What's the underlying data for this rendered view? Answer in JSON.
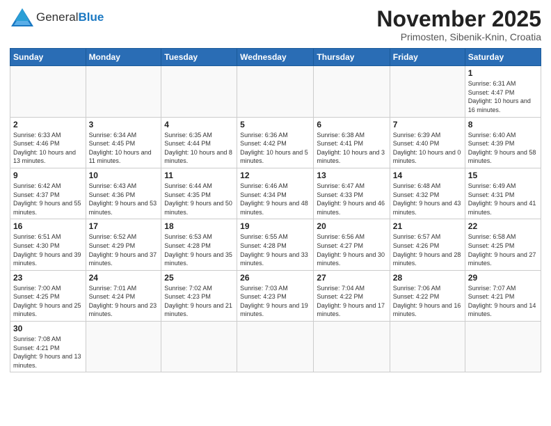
{
  "logo": {
    "text_general": "General",
    "text_blue": "Blue"
  },
  "header": {
    "month_title": "November 2025",
    "subtitle": "Primosten, Sibenik-Knin, Croatia"
  },
  "weekdays": [
    "Sunday",
    "Monday",
    "Tuesday",
    "Wednesday",
    "Thursday",
    "Friday",
    "Saturday"
  ],
  "weeks": [
    [
      null,
      null,
      null,
      null,
      null,
      null,
      {
        "day": "1",
        "sunrise": "6:31 AM",
        "sunset": "4:47 PM",
        "daylight": "10 hours and 16 minutes."
      }
    ],
    [
      {
        "day": "2",
        "sunrise": "6:33 AM",
        "sunset": "4:46 PM",
        "daylight": "10 hours and 13 minutes."
      },
      {
        "day": "3",
        "sunrise": "6:34 AM",
        "sunset": "4:45 PM",
        "daylight": "10 hours and 11 minutes."
      },
      {
        "day": "4",
        "sunrise": "6:35 AM",
        "sunset": "4:44 PM",
        "daylight": "10 hours and 8 minutes."
      },
      {
        "day": "5",
        "sunrise": "6:36 AM",
        "sunset": "4:42 PM",
        "daylight": "10 hours and 5 minutes."
      },
      {
        "day": "6",
        "sunrise": "6:38 AM",
        "sunset": "4:41 PM",
        "daylight": "10 hours and 3 minutes."
      },
      {
        "day": "7",
        "sunrise": "6:39 AM",
        "sunset": "4:40 PM",
        "daylight": "10 hours and 0 minutes."
      },
      {
        "day": "8",
        "sunrise": "6:40 AM",
        "sunset": "4:39 PM",
        "daylight": "9 hours and 58 minutes."
      }
    ],
    [
      {
        "day": "9",
        "sunrise": "6:42 AM",
        "sunset": "4:37 PM",
        "daylight": "9 hours and 55 minutes."
      },
      {
        "day": "10",
        "sunrise": "6:43 AM",
        "sunset": "4:36 PM",
        "daylight": "9 hours and 53 minutes."
      },
      {
        "day": "11",
        "sunrise": "6:44 AM",
        "sunset": "4:35 PM",
        "daylight": "9 hours and 50 minutes."
      },
      {
        "day": "12",
        "sunrise": "6:46 AM",
        "sunset": "4:34 PM",
        "daylight": "9 hours and 48 minutes."
      },
      {
        "day": "13",
        "sunrise": "6:47 AM",
        "sunset": "4:33 PM",
        "daylight": "9 hours and 46 minutes."
      },
      {
        "day": "14",
        "sunrise": "6:48 AM",
        "sunset": "4:32 PM",
        "daylight": "9 hours and 43 minutes."
      },
      {
        "day": "15",
        "sunrise": "6:49 AM",
        "sunset": "4:31 PM",
        "daylight": "9 hours and 41 minutes."
      }
    ],
    [
      {
        "day": "16",
        "sunrise": "6:51 AM",
        "sunset": "4:30 PM",
        "daylight": "9 hours and 39 minutes."
      },
      {
        "day": "17",
        "sunrise": "6:52 AM",
        "sunset": "4:29 PM",
        "daylight": "9 hours and 37 minutes."
      },
      {
        "day": "18",
        "sunrise": "6:53 AM",
        "sunset": "4:28 PM",
        "daylight": "9 hours and 35 minutes."
      },
      {
        "day": "19",
        "sunrise": "6:55 AM",
        "sunset": "4:28 PM",
        "daylight": "9 hours and 33 minutes."
      },
      {
        "day": "20",
        "sunrise": "6:56 AM",
        "sunset": "4:27 PM",
        "daylight": "9 hours and 30 minutes."
      },
      {
        "day": "21",
        "sunrise": "6:57 AM",
        "sunset": "4:26 PM",
        "daylight": "9 hours and 28 minutes."
      },
      {
        "day": "22",
        "sunrise": "6:58 AM",
        "sunset": "4:25 PM",
        "daylight": "9 hours and 27 minutes."
      }
    ],
    [
      {
        "day": "23",
        "sunrise": "7:00 AM",
        "sunset": "4:25 PM",
        "daylight": "9 hours and 25 minutes."
      },
      {
        "day": "24",
        "sunrise": "7:01 AM",
        "sunset": "4:24 PM",
        "daylight": "9 hours and 23 minutes."
      },
      {
        "day": "25",
        "sunrise": "7:02 AM",
        "sunset": "4:23 PM",
        "daylight": "9 hours and 21 minutes."
      },
      {
        "day": "26",
        "sunrise": "7:03 AM",
        "sunset": "4:23 PM",
        "daylight": "9 hours and 19 minutes."
      },
      {
        "day": "27",
        "sunrise": "7:04 AM",
        "sunset": "4:22 PM",
        "daylight": "9 hours and 17 minutes."
      },
      {
        "day": "28",
        "sunrise": "7:06 AM",
        "sunset": "4:22 PM",
        "daylight": "9 hours and 16 minutes."
      },
      {
        "day": "29",
        "sunrise": "7:07 AM",
        "sunset": "4:21 PM",
        "daylight": "9 hours and 14 minutes."
      }
    ],
    [
      {
        "day": "30",
        "sunrise": "7:08 AM",
        "sunset": "4:21 PM",
        "daylight": "9 hours and 13 minutes."
      },
      null,
      null,
      null,
      null,
      null,
      null
    ]
  ]
}
